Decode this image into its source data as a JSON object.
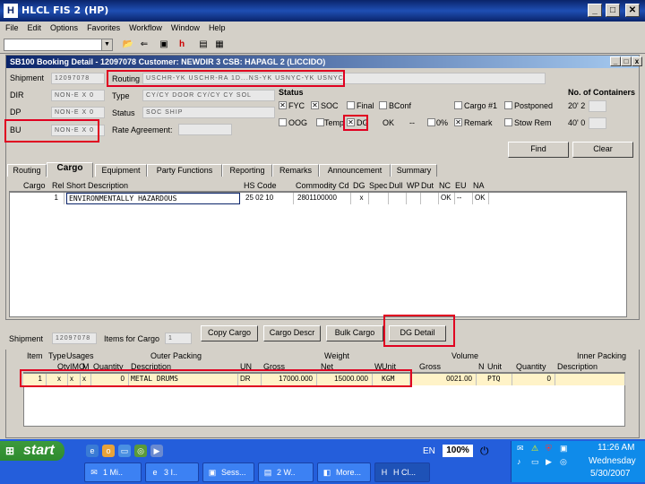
{
  "window": {
    "title": "HLCL FIS 2 (HP)",
    "icon": "app-icon"
  },
  "menu": [
    "File",
    "Edit",
    "Options",
    "Favorites",
    "Workflow",
    "Window",
    "Help"
  ],
  "inner_window": {
    "title": "SB100 Booking Detail - 12097078 Customer: NEWDIR 3 CSB: HAPAGL 2 (LICCIDO)"
  },
  "header_fields": {
    "shipment_label": "Shipment",
    "shipment_value": "12097078",
    "dir_label": "DIR",
    "dir_value": "NON-E X 0",
    "dp_label": "DP",
    "dp_value": "NON-E X 0",
    "bu_label": "BU",
    "bu_value": "NON-E X 0",
    "routing_label": "Routing",
    "routing_value": "USCHR-YK USCHR-RA 1D...NS-YK USNYC-YK USNYC",
    "type_label": "Type",
    "type_value": "CY/CY DOOR CY/CY CY SOL",
    "status_label": "Status",
    "status_value": "SOC SHIP",
    "rate_label": "Rate Agreement:",
    "status_group": "Status",
    "containers_label": "No. of Containers",
    "row1": [
      "FYC",
      "SOC",
      "Final",
      "BConf",
      "Cargo #1",
      "Postponed"
    ],
    "row1_count": "20' 2",
    "row2": [
      "OOG",
      "Temp",
      "DG",
      "OK",
      "--",
      "0%",
      "Remark",
      "Stow Rem"
    ],
    "row2_count": "40' 0",
    "find_label": "Find",
    "clear_label": "Clear"
  },
  "tabs": [
    "Routing",
    "Cargo",
    "Equipment",
    "Party Functions",
    "Reporting",
    "Remarks",
    "Announcement",
    "Summary"
  ],
  "cargo_grid": {
    "headers": [
      "Cargo",
      "Rel",
      "Short Description",
      "HS Code",
      "Commodity Cd",
      "DG",
      "Spec",
      "Dull",
      "WP",
      "Dut",
      "NC",
      "EU",
      "NA"
    ],
    "rows": [
      [
        "1",
        "",
        "ENVIRONMENTALLY HAZARDOUS",
        "25 02 10",
        "2801100000",
        "x",
        "",
        "",
        "",
        "",
        "OK",
        "--",
        "OK"
      ]
    ]
  },
  "lower": {
    "shipment_label": "Shipment",
    "shipment_value": "12097078",
    "items_label": "Items for Cargo",
    "items_value": "1",
    "copy_cargo": "Copy Cargo",
    "cargo_descr": "Cargo Descr",
    "bulk_cargo": "Bulk Cargo",
    "dg_detail": "DG Detail",
    "group_headers": [
      "Item",
      "Type",
      "Usages",
      "Outer Packing",
      "Weight",
      "Volume",
      "Inner Packing"
    ],
    "sub_headers": [
      "Qty",
      "IMO",
      "M",
      "Quantity",
      "Description",
      "UN",
      "Gross",
      "Net",
      "W",
      "Unit",
      "Gross",
      "N",
      "Unit",
      "Quantity",
      "Description"
    ],
    "row": [
      "1",
      "x",
      "x",
      "x",
      "0",
      "METAL DRUMS",
      "DR",
      "17000.000",
      "15000.000",
      "KGM",
      "0021.00",
      "",
      "PTQ",
      "0",
      ""
    ]
  },
  "taskbar": {
    "start": "start",
    "tasks": [
      "1 Mi..",
      "3 I..",
      "Sess...",
      "2 W..",
      "More...",
      "H Cl..."
    ],
    "lang": "EN",
    "zoom": "100%",
    "clock_time": "11:26 AM",
    "clock_day": "Wednesday",
    "clock_date": "5/30/2007"
  }
}
